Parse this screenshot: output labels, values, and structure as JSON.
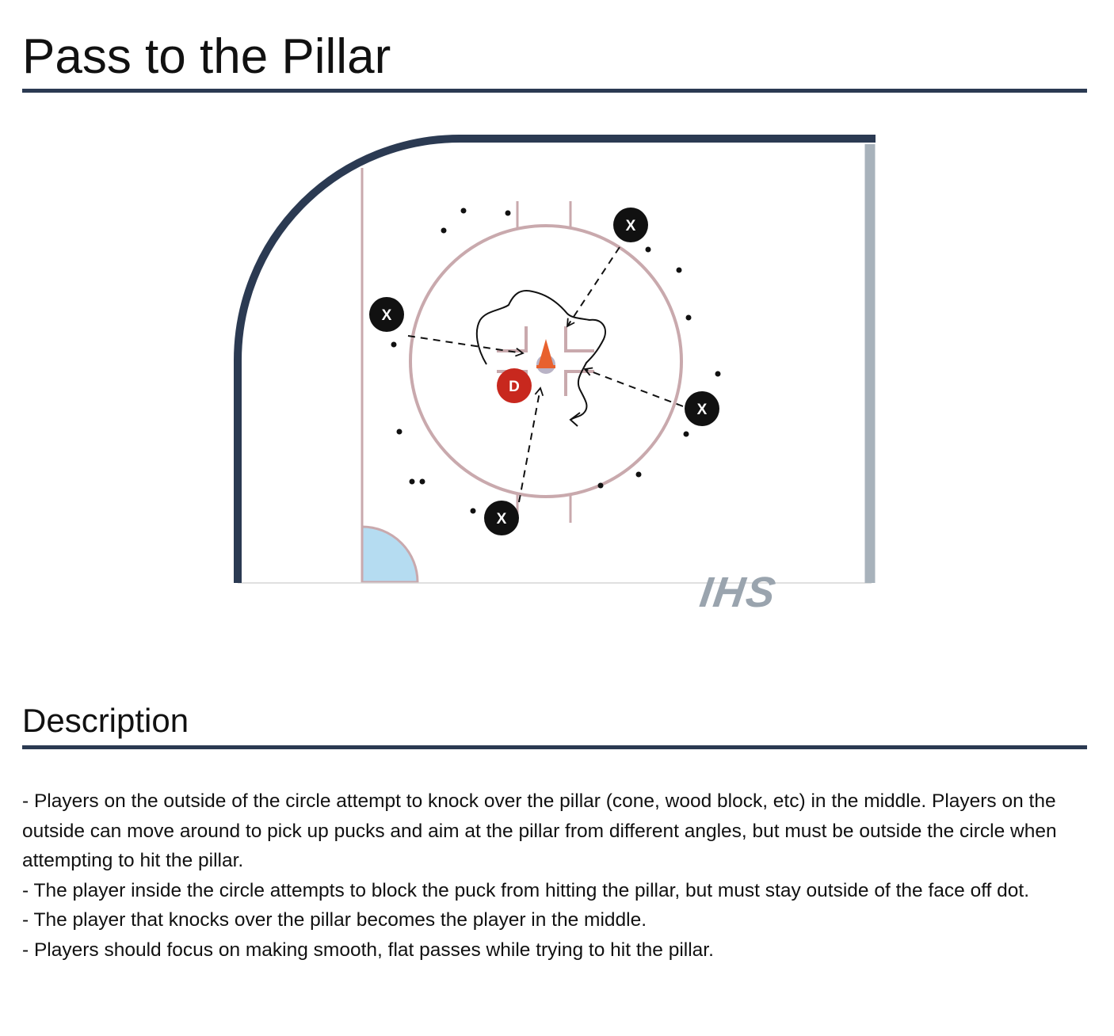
{
  "title": "Pass to the Pillar",
  "diagram": {
    "player_marker_label": "X",
    "defender_marker_label": "D",
    "logo_text": "IHS",
    "colors": {
      "boards": "#2b3a52",
      "end_boards": "#a8b2bb",
      "rink_lines": "#c9a9ad",
      "crease": "#b5dcf1",
      "defender": "#c8281e",
      "cone": "#e8612e",
      "player": "#111111",
      "logo": "#9aa4ae"
    },
    "icons": [
      "cone-icon",
      "puck-icon",
      "player-icon",
      "defender-icon"
    ]
  },
  "description": {
    "heading": "Description",
    "paragraphs": [
      "- Players on the outside of the circle attempt to knock over the pillar (cone, wood block, etc) in the middle. Players on the outside can move around to pick up pucks and aim at the pillar from different angles, but must be outside the circle when attempting to hit the pillar.",
      "- The player inside the circle attempts to block the puck from hitting the pillar, but must stay outside of the face off dot.",
      "- The player that knocks over the pillar becomes the player in the middle.",
      "- Players should focus on making smooth, flat passes while trying to hit the pillar."
    ]
  }
}
